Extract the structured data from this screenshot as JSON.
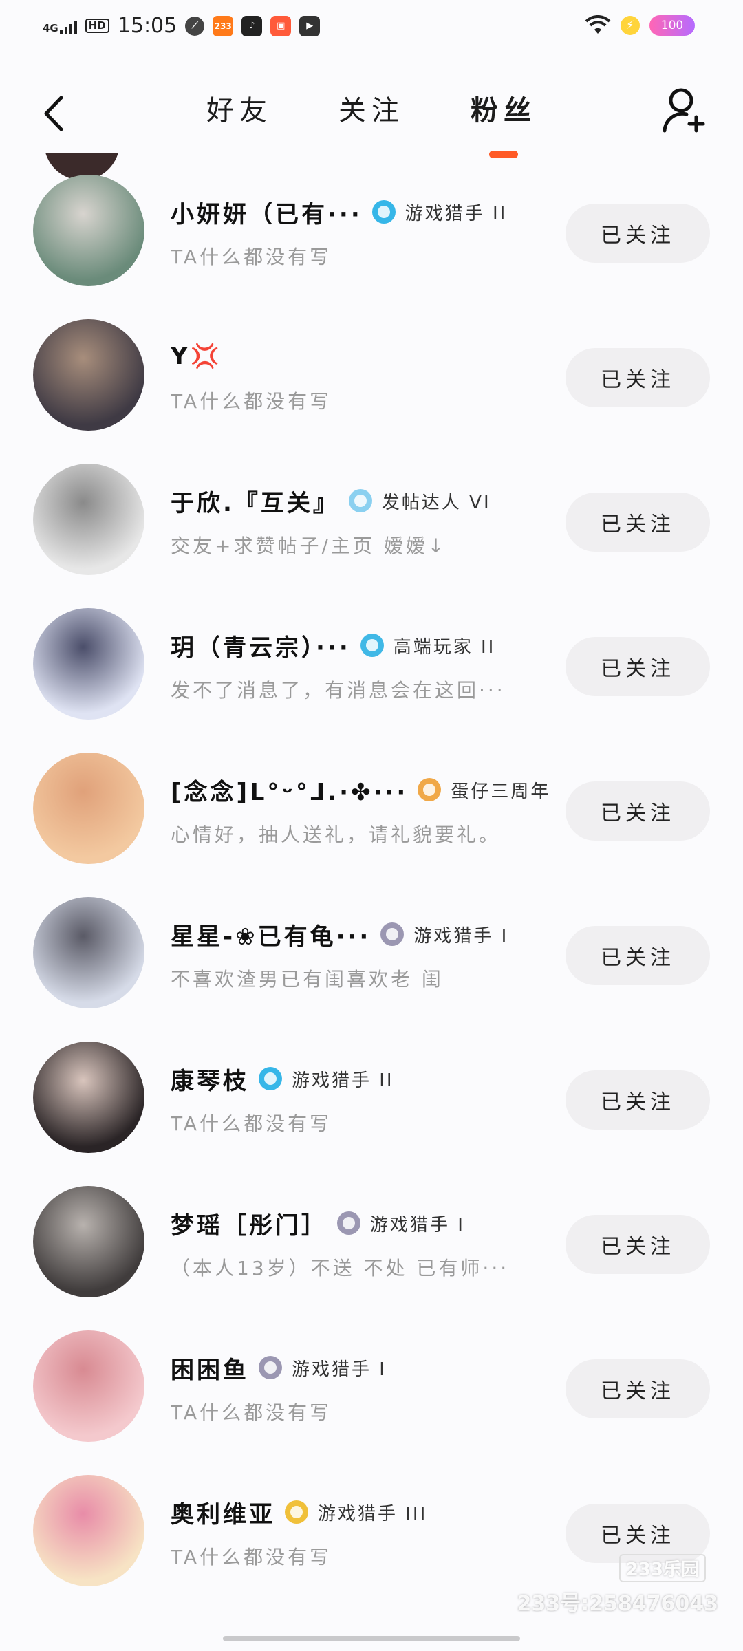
{
  "status_bar": {
    "signal": "4G",
    "hd": "HD",
    "time": "15:05",
    "app_icon_label": "233",
    "battery": "100"
  },
  "header": {
    "tabs": [
      {
        "label": "好友",
        "active": false
      },
      {
        "label": "关注",
        "active": false
      },
      {
        "label": "粉丝",
        "active": true
      }
    ]
  },
  "accent_color": "#ff5a26",
  "rows": [
    {
      "name": "小妍妍（已有···",
      "badge": "游戏猎手 II",
      "badge_color": "#36b6e8",
      "bio": "TA什么都没有写",
      "button": "已关注",
      "avatar_colors": [
        "#6a8b7a",
        "#d8d4cf"
      ]
    },
    {
      "name": "Y💢",
      "badge": "",
      "badge_color": "",
      "bio": "TA什么都没有写",
      "button": "已关注",
      "avatar_colors": [
        "#3f3a44",
        "#a88e7c"
      ]
    },
    {
      "name": "于欣.『互关』",
      "badge": "发帖达人 VI",
      "badge_color": "#8ad0f0",
      "bio": "交友+求赞帖子/主页 嫒嫒↓",
      "button": "已关注",
      "avatar_colors": [
        "#e7e7e7",
        "#8a8a8a"
      ]
    },
    {
      "name": "玥（青云宗）···",
      "badge": "高端玩家 II",
      "badge_color": "#40b8e6",
      "bio": "发不了消息了，有消息会在这回···",
      "button": "已关注",
      "avatar_colors": [
        "#dfe3f3",
        "#4b4e6a"
      ]
    },
    {
      "name": "[念念]ᒪ°ᵕ°ᒧ.·✤···",
      "badge": "蛋仔三周年",
      "badge_color": "#f0a848",
      "bio": "心情好，抽人送礼，请礼貌要礼。",
      "button": "已关注",
      "avatar_colors": [
        "#f3c9a0",
        "#e0a17a"
      ]
    },
    {
      "name": "星星-❀已有龟···",
      "badge": "游戏猎手 I",
      "badge_color": "#9b97b2",
      "bio": "不喜欢渣男已有闺喜欢老 闺",
      "button": "已关注",
      "avatar_colors": [
        "#d6dbe8",
        "#5a5a66"
      ]
    },
    {
      "name": "康琴枝",
      "badge": "游戏猎手 II",
      "badge_color": "#36b6e8",
      "bio": "TA什么都没有写",
      "button": "已关注",
      "avatar_colors": [
        "#2a2426",
        "#d9c5bd"
      ]
    },
    {
      "name": "梦瑶［彤门］",
      "badge": "游戏猎手 I",
      "badge_color": "#9b97b2",
      "bio": "（本人13岁）不送 不处 已有师···",
      "button": "已关注",
      "avatar_colors": [
        "#403c3c",
        "#b8b2ae"
      ]
    },
    {
      "name": "困困鱼",
      "badge": "游戏猎手 I",
      "badge_color": "#9b97b2",
      "bio": "TA什么都没有写",
      "button": "已关注",
      "avatar_colors": [
        "#f4c9cd",
        "#d88a92"
      ]
    },
    {
      "name": "奥利维亚",
      "badge": "游戏猎手 III",
      "badge_color": "#f0c03a",
      "bio": "TA什么都没有写",
      "button": "已关注",
      "avatar_colors": [
        "#f7e3c4",
        "#e88ca8"
      ]
    }
  ],
  "watermark": {
    "logo": "233乐园",
    "account": "233号:258476043"
  }
}
